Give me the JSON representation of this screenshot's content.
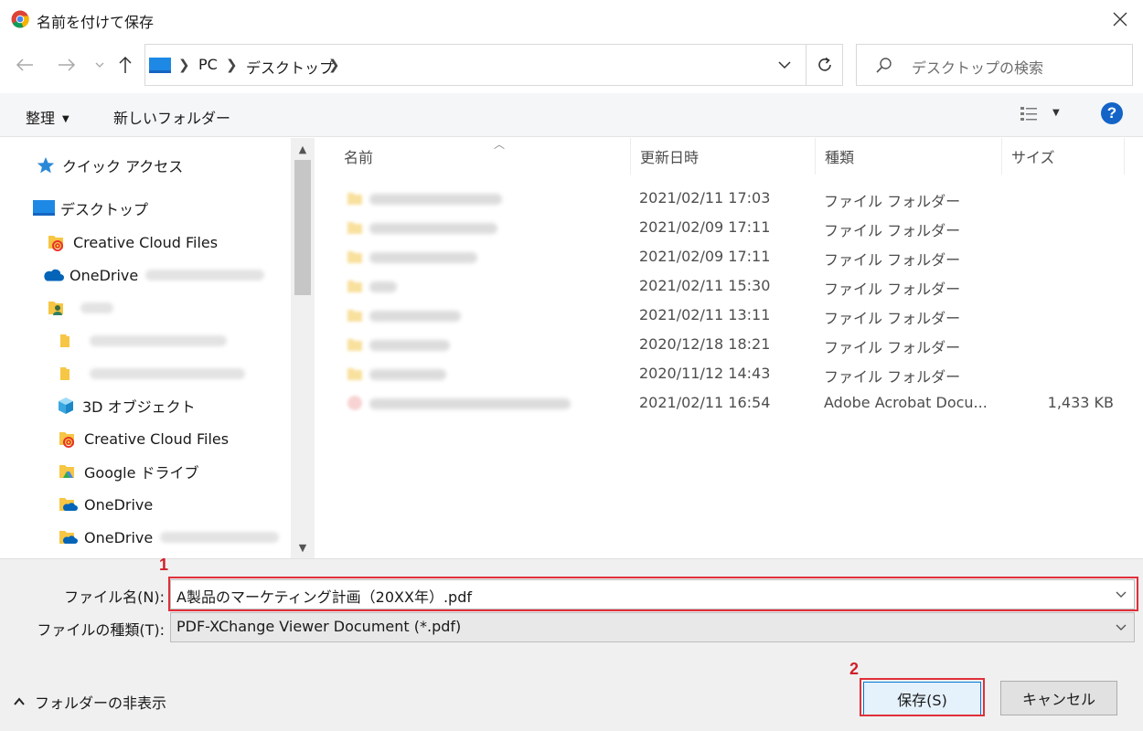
{
  "window": {
    "title": "名前を付けて保存"
  },
  "address": {
    "crumbs": [
      "PC",
      "デスクトップ"
    ]
  },
  "search": {
    "placeholder": "デスクトップの検索"
  },
  "toolbar": {
    "organize_label": "整理",
    "new_folder_label": "新しいフォルダー"
  },
  "nav": {
    "quick_access": "クイック アクセス",
    "desktop": "デスクトップ",
    "creative_cloud_1": "Creative Cloud Files",
    "onedrive_1": "OneDrive",
    "objects_3d": "3D オブジェクト",
    "creative_cloud_2": "Creative Cloud Files",
    "google_drive": "Google ドライブ",
    "onedrive_2": "OneDrive",
    "onedrive_3": "OneDrive"
  },
  "columns": {
    "name": "名前",
    "modified": "更新日時",
    "type": "種類",
    "size": "サイズ"
  },
  "files": [
    {
      "date": "2021/02/11 17:03",
      "type": "ファイル フォルダー",
      "size": "",
      "kind": "folder"
    },
    {
      "date": "2021/02/09 17:11",
      "type": "ファイル フォルダー",
      "size": "",
      "kind": "folder"
    },
    {
      "date": "2021/02/09 17:11",
      "type": "ファイル フォルダー",
      "size": "",
      "kind": "folder"
    },
    {
      "date": "2021/02/11 15:30",
      "type": "ファイル フォルダー",
      "size": "",
      "kind": "folder"
    },
    {
      "date": "2021/02/11 13:11",
      "type": "ファイル フォルダー",
      "size": "",
      "kind": "folder"
    },
    {
      "date": "2020/12/18 18:21",
      "type": "ファイル フォルダー",
      "size": "",
      "kind": "folder"
    },
    {
      "date": "2020/11/12 14:43",
      "type": "ファイル フォルダー",
      "size": "",
      "kind": "folder"
    },
    {
      "date": "2021/02/11 16:54",
      "type": "Adobe Acrobat Docu...",
      "size": "1,433 KB",
      "kind": "pdf"
    }
  ],
  "form": {
    "filename_label": "ファイル名(N):",
    "filename_value": "A製品のマーケティング計画（20XX年）.pdf",
    "filetype_label": "ファイルの種類(T):",
    "filetype_value": "PDF-XChange Viewer Document (*.pdf)"
  },
  "footer": {
    "hide_folders_label": "フォルダーの非表示",
    "save_label": "保存(S)",
    "cancel_label": "キャンセル"
  },
  "annotations": {
    "step1": "1",
    "step2": "2"
  },
  "colors": {
    "accent": "#0078d7",
    "annotation": "#e0303a",
    "help": "#1464c8"
  }
}
